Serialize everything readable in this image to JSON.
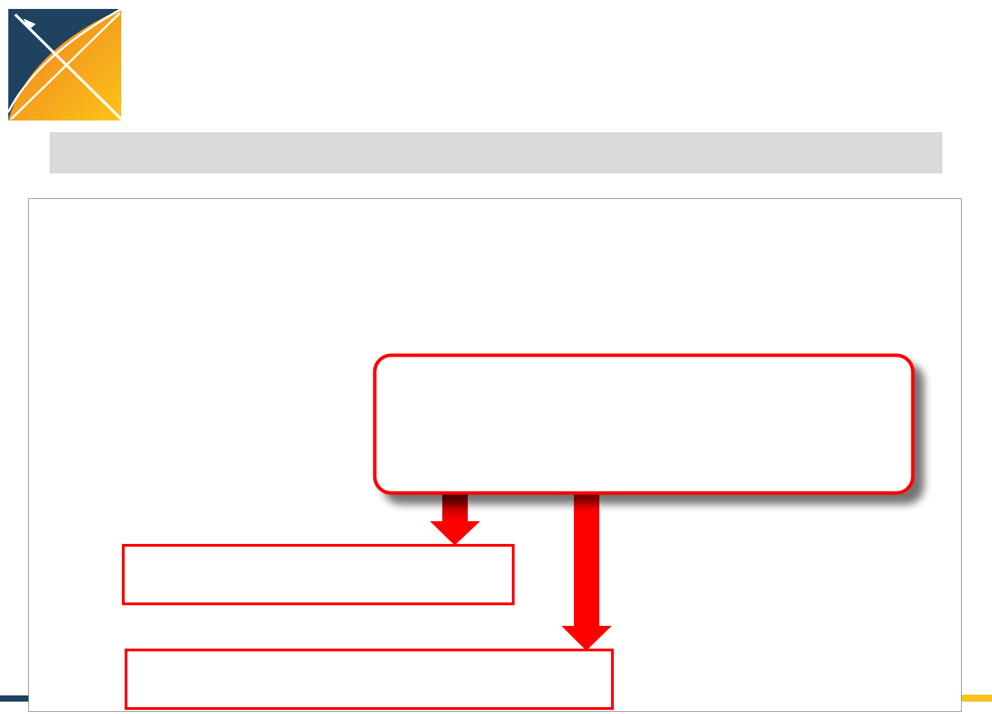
{
  "colors": {
    "logo_navy": "#1f4260",
    "logo_orange": "#f08a24",
    "logo_yellow": "#fbc418",
    "title_bar": "#d9d9d9",
    "diagram_red": "#ff0000",
    "frame_border": "#8a8a8a"
  },
  "slide": {
    "title": ""
  },
  "diagram": {
    "source_box": {
      "label": ""
    },
    "target_box_upper": {
      "label": ""
    },
    "target_box_lower": {
      "label": ""
    }
  }
}
